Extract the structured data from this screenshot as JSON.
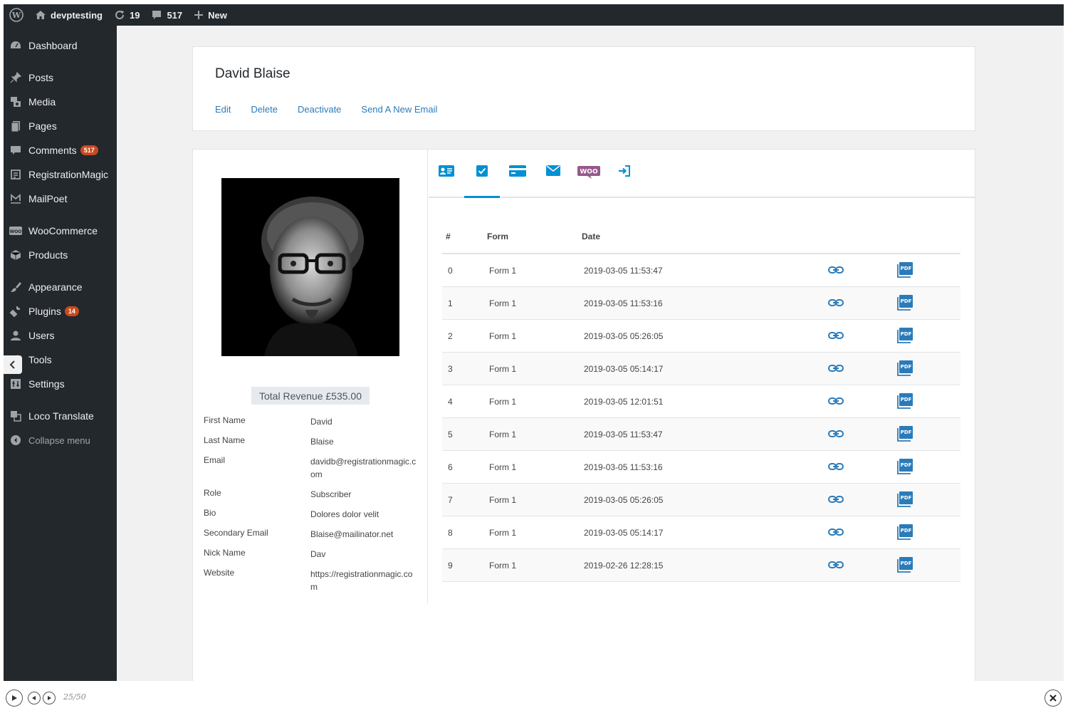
{
  "adminbar": {
    "site_name": "devptesting",
    "updates_count": "19",
    "comments_count": "517",
    "new_label": "New"
  },
  "sidebar": {
    "items": [
      {
        "label": "Dashboard",
        "icon": "dashboard-icon"
      },
      {
        "label": "Posts",
        "icon": "pin-icon"
      },
      {
        "label": "Media",
        "icon": "media-icon"
      },
      {
        "label": "Pages",
        "icon": "pages-icon"
      },
      {
        "label": "Comments",
        "icon": "comment-icon",
        "badge": "517"
      },
      {
        "label": "RegistrationMagic",
        "icon": "form-icon"
      },
      {
        "label": "MailPoet",
        "icon": "mailpoet-icon"
      },
      {
        "label": "WooCommerce",
        "icon": "woo-icon"
      },
      {
        "label": "Products",
        "icon": "box-icon"
      },
      {
        "label": "Appearance",
        "icon": "brush-icon"
      },
      {
        "label": "Plugins",
        "icon": "plug-icon",
        "badge": "14"
      },
      {
        "label": "Users",
        "icon": "user-icon"
      },
      {
        "label": "Tools",
        "icon": "wrench-icon"
      },
      {
        "label": "Settings",
        "icon": "settings-icon"
      },
      {
        "label": "Loco Translate",
        "icon": "translate-icon"
      }
    ],
    "collapse_label": "Collapse menu"
  },
  "header": {
    "user_name": "David Blaise",
    "actions": [
      "Edit",
      "Delete",
      "Deactivate",
      "Send A New Email"
    ]
  },
  "profile": {
    "revenue": "Total Revenue £535.00",
    "fields": [
      {
        "label": "First Name",
        "value": "David"
      },
      {
        "label": "Last Name",
        "value": "Blaise"
      },
      {
        "label": "Email",
        "value": "davidb@registrationmagic.com"
      },
      {
        "label": "Role",
        "value": "Subscriber"
      },
      {
        "label": "Bio",
        "value": "Dolores dolor velit"
      },
      {
        "label": "Secondary Email",
        "value": "Blaise@mailinator.net"
      },
      {
        "label": "Nick Name",
        "value": "Dav"
      },
      {
        "label": "Website",
        "value": "https://registrationmagic.com"
      }
    ]
  },
  "tabs": {
    "icons": [
      "id-card-icon",
      "checkbox-icon",
      "credit-card-icon",
      "envelope-icon",
      "woo-logo-icon",
      "login-icon"
    ],
    "woo_text": "WOO",
    "active_index": 1
  },
  "submissions": {
    "headers": {
      "num": "#",
      "form": "Form",
      "date": "Date"
    },
    "pdf_text": "PDF",
    "rows": [
      {
        "num": "0",
        "form": "Form 1",
        "date": "2019-03-05 11:53:47"
      },
      {
        "num": "1",
        "form": "Form 1",
        "date": "2019-03-05 11:53:16"
      },
      {
        "num": "2",
        "form": "Form 1",
        "date": "2019-03-05 05:26:05"
      },
      {
        "num": "3",
        "form": "Form 1",
        "date": "2019-03-05 05:14:17"
      },
      {
        "num": "4",
        "form": "Form 1",
        "date": "2019-03-05 12:01:51"
      },
      {
        "num": "5",
        "form": "Form 1",
        "date": "2019-03-05 11:53:47"
      },
      {
        "num": "6",
        "form": "Form 1",
        "date": "2019-03-05 11:53:16"
      },
      {
        "num": "7",
        "form": "Form 1",
        "date": "2019-03-05 05:26:05"
      },
      {
        "num": "8",
        "form": "Form 1",
        "date": "2019-03-05 05:14:17"
      },
      {
        "num": "9",
        "form": "Form 1",
        "date": "2019-02-26 12:28:15"
      }
    ]
  },
  "player": {
    "counter": "25/50"
  },
  "colors": {
    "admin_dark": "#23282d",
    "link_blue": "#2b7bb9",
    "tab_blue": "#0090d3",
    "badge_red": "#ca4a1f",
    "woo_purple": "#96588a"
  }
}
